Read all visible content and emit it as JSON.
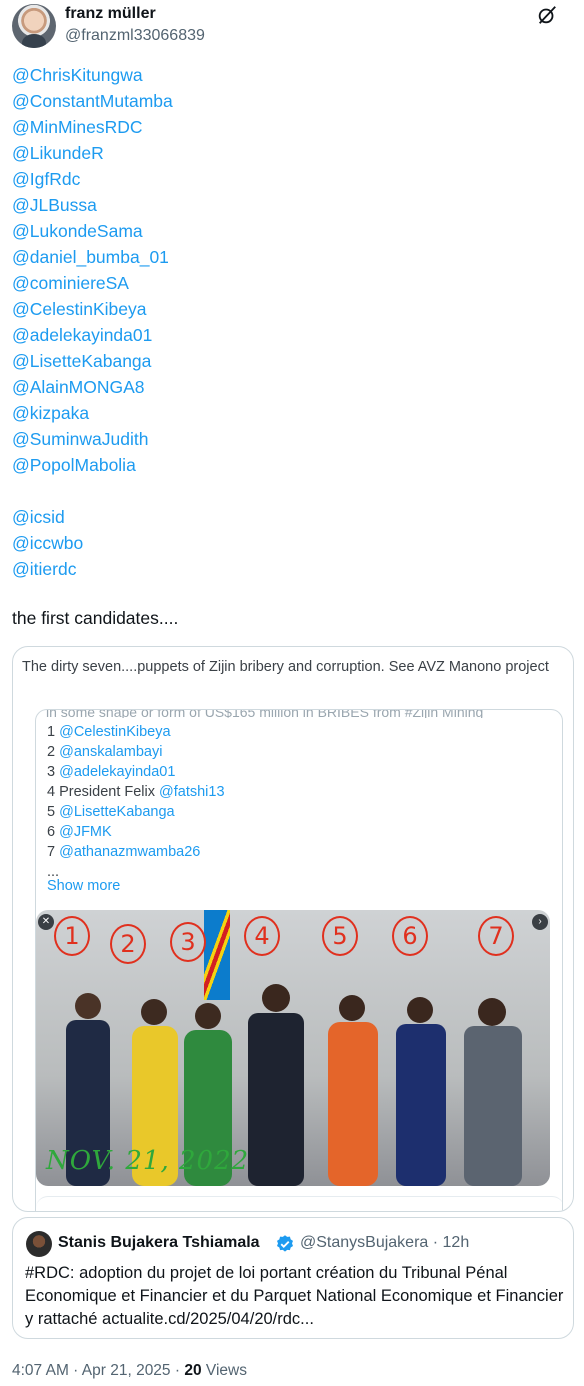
{
  "author": {
    "display_name": "franz müller",
    "handle": "@franzml33066839"
  },
  "mentions_group1": [
    "@ChrisKitungwa",
    "@ConstantMutamba",
    "@MinMinesRDC",
    "@LikundeR",
    "@IgfRdc",
    "@JLBussa",
    "@LukondeSama",
    "@daniel_bumba_01",
    "@cominiereSA",
    "@CelestinKibeya",
    "@adelekayinda01",
    "@LisetteKabanga",
    "@AlainMONGA8",
    "@kizpaka",
    "@SuminwaJudith",
    "@PopolMabolia"
  ],
  "mentions_group2": [
    "@icsid",
    "@iccwbo",
    "@itierdc"
  ],
  "tweet_text": "the first candidates....",
  "embedded_post": {
    "text": "The dirty seven....puppets of Zijin bribery and corruption.  See AVZ Manono project",
    "inner": {
      "cut_text": "in some shape or form of US$165 million in BRIBES from #Zijin Mining",
      "list": [
        {
          "prefix": "1 ",
          "link": "@CelestinKibeya"
        },
        {
          "prefix": "2 ",
          "link": "@anskalambayi"
        },
        {
          "prefix": "3 ",
          "link": "@adelekayinda01"
        },
        {
          "prefix": "4 President Felix ",
          "link": "@fatshi13"
        },
        {
          "prefix": "5 ",
          "link": "@LisetteKabanga"
        },
        {
          "prefix": "6 ",
          "link": "@JFMK"
        },
        {
          "prefix": "7 ",
          "link": "@athanazmwamba26"
        }
      ],
      "ellipsis": "...",
      "show_more": "Show more",
      "photo": {
        "numbers": [
          "1",
          "2",
          "3",
          "4",
          "5",
          "6",
          "7"
        ],
        "date_stamp": "NOV. 21, 2022"
      }
    }
  },
  "quoted_post": {
    "name": "Stanis Bujakera Tshiamala",
    "handle_time": "@StanysBujakera · 12h",
    "text": "#RDC: adoption du projet de loi portant création du Tribunal Pénal Economique et Financier et du Parquet National Economique et Financier y rattaché actualite.cd/2025/04/20/rdc..."
  },
  "footer": {
    "timestamp": "4:07 AM · Apr 21, 2025 · ",
    "views_count": "20",
    "views_label": " Views"
  },
  "colors": {
    "link": "#1d9bf0",
    "text": "#0f1419",
    "secondary": "#536471",
    "border": "#cfd9de",
    "annotation_red": "#e0301e",
    "annotation_green": "#2fa83c"
  }
}
